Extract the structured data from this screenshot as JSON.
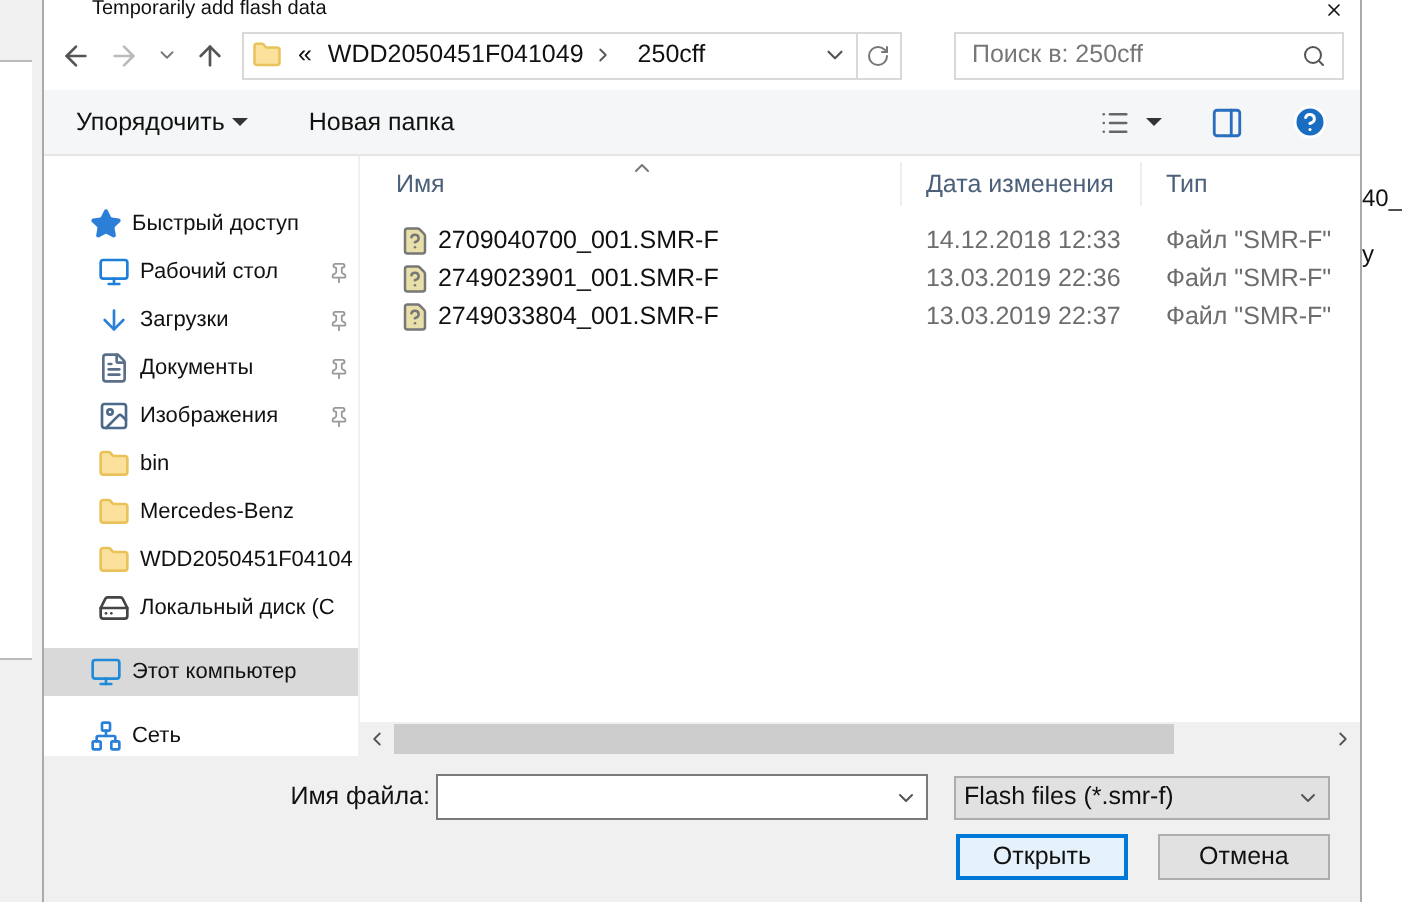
{
  "window": {
    "title": "Temporarily add flash data"
  },
  "background": {
    "text_1": "40_",
    "text_2": "y"
  },
  "address_bar": {
    "overflow": "«",
    "segments": [
      "WDD2050451F041049",
      "250cff"
    ]
  },
  "search": {
    "placeholder": "Поиск в: 250cff"
  },
  "toolbar": {
    "organize": "Упорядочить",
    "new_folder": "Новая папка"
  },
  "sidebar": {
    "items": [
      {
        "label": "Быстрый доступ",
        "kind": "star",
        "pinned": false,
        "selected": false,
        "children": [
          {
            "label": "Рабочий стол",
            "kind": "desktop",
            "pinned": true,
            "selected": false
          },
          {
            "label": "Загрузки",
            "kind": "download",
            "pinned": true,
            "selected": false
          },
          {
            "label": "Документы",
            "kind": "document",
            "pinned": true,
            "selected": false
          },
          {
            "label": "Изображения",
            "kind": "picture",
            "pinned": true,
            "selected": false
          },
          {
            "label": "bin",
            "kind": "folder",
            "pinned": false,
            "selected": false
          },
          {
            "label": "Mercedes-Benz",
            "kind": "folder",
            "pinned": false,
            "selected": false
          },
          {
            "label": "WDD2050451F04104",
            "kind": "folder",
            "pinned": false,
            "selected": false
          },
          {
            "label": "Локальный диск (С",
            "kind": "drive",
            "pinned": false,
            "selected": false
          }
        ]
      },
      {
        "label": "Этот компьютер",
        "kind": "computer",
        "pinned": false,
        "selected": true
      },
      {
        "label": "Сеть",
        "kind": "network",
        "pinned": false,
        "selected": false
      }
    ]
  },
  "table": {
    "columns": [
      "Имя",
      "Дата изменения",
      "Тип"
    ],
    "rows": [
      {
        "name": "2709040700_001.SMR-F",
        "date": "14.12.2018 12:33",
        "type": "Файл \"SMR-F\""
      },
      {
        "name": "2749023901_001.SMR-F",
        "date": "13.03.2019 22:36",
        "type": "Файл \"SMR-F\""
      },
      {
        "name": "2749033804_001.SMR-F",
        "date": "13.03.2019 22:37",
        "type": "Файл \"SMR-F\""
      }
    ]
  },
  "footer": {
    "filename_label": "Имя файла:",
    "filter": "Flash files (*.smr-f)",
    "buttons": [
      "Открыть",
      "Отмена"
    ]
  }
}
